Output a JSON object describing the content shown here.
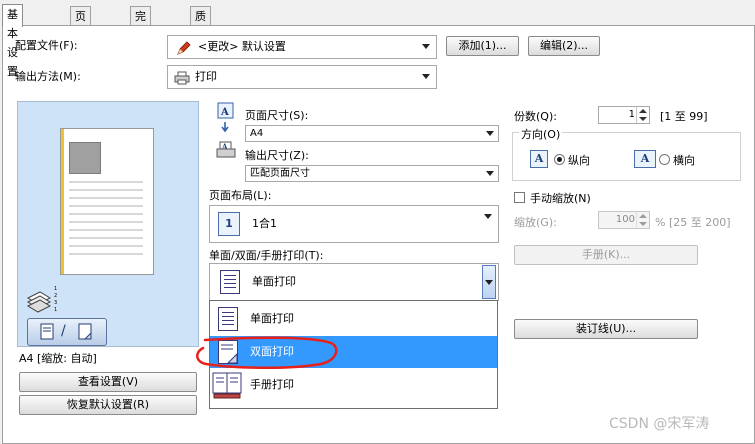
{
  "tabs": [
    "基本设置",
    "页面设置",
    "完成方式",
    "质量"
  ],
  "profile": {
    "label": "配置文件(F):",
    "value": "<更改> 默认设置",
    "add_button": "添加(1)...",
    "edit_button": "编辑(2)..."
  },
  "output_method": {
    "label": "输出方法(M):",
    "value": "打印"
  },
  "preview": {
    "status": "A4 [缩放: 自动]",
    "view_settings_button": "查看设置(V)",
    "restore_defaults_button": "恢复默认设置(R)"
  },
  "page_size": {
    "label": "页面尺寸(S):",
    "value": "A4"
  },
  "output_size": {
    "label": "输出尺寸(Z):",
    "value": "匹配页面尺寸"
  },
  "page_layout": {
    "label": "页面布局(L):",
    "value": "1合1",
    "icon_text": "1"
  },
  "print_style": {
    "label": "单面/双面/手册打印(T):",
    "value": "单面打印",
    "options": [
      "单面打印",
      "双面打印",
      "手册打印"
    ],
    "highlighted": "双面打印"
  },
  "copies": {
    "label": "份数(Q):",
    "value": "1",
    "range": "[1 至 99]"
  },
  "orientation": {
    "label": "方向(O)",
    "portrait": "纵向",
    "landscape": "横向",
    "selected": "portrait"
  },
  "manual_scaling": {
    "label": "手动缩放(N)",
    "checked": false
  },
  "scaling": {
    "label": "缩放(G):",
    "value": "100",
    "range": "% [25 至 200]"
  },
  "booklet_button": "手册(K)...",
  "binding_button": "装订线(U)...",
  "watermark": "CSDN @宋军涛",
  "colors": {
    "highlight": "#3399ff",
    "annotation": "#e8201a",
    "preview_bg": "#cfe3f8"
  }
}
